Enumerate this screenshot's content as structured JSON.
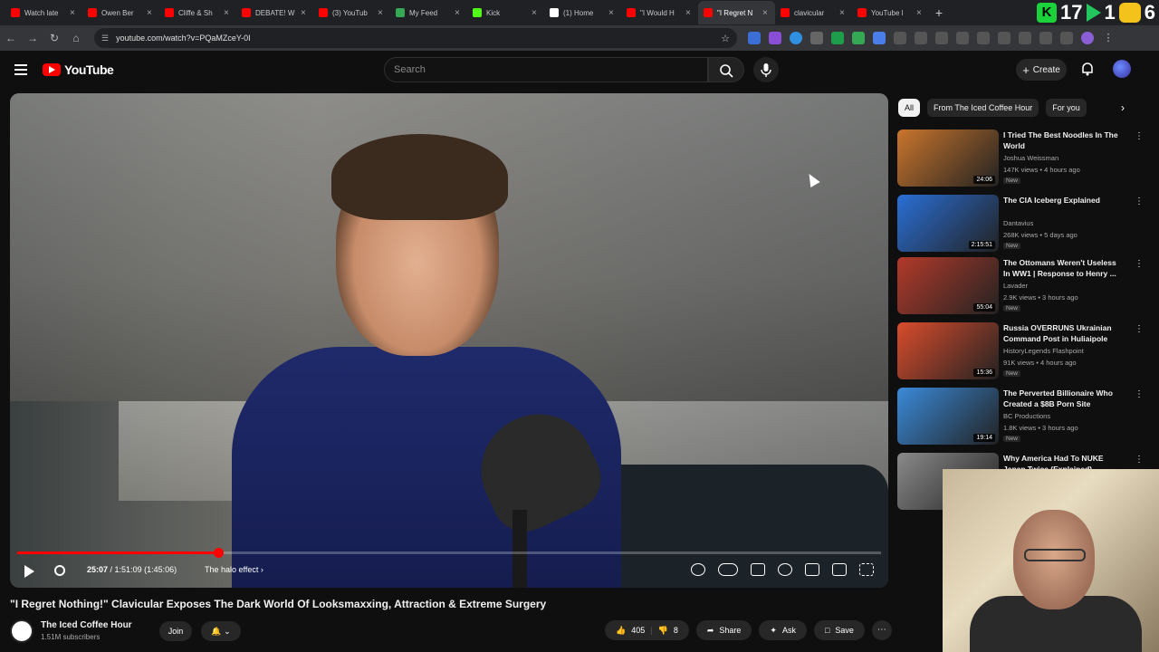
{
  "browser": {
    "tabs": [
      {
        "title": "Watch late",
        "color": "#ff0000"
      },
      {
        "title": "Owen Ber",
        "color": "#ff0000"
      },
      {
        "title": "Cliffe & Sh",
        "color": "#ff0000"
      },
      {
        "title": "DEBATE! W",
        "color": "#ff0000"
      },
      {
        "title": "(3) YouTub",
        "color": "#ff0000"
      },
      {
        "title": "My Feed",
        "color": "#34a853"
      },
      {
        "title": "Kick",
        "color": "#53fc18"
      },
      {
        "title": "(1) Home",
        "color": "#ffffff"
      },
      {
        "title": "\"I Would H",
        "color": "#ff0000"
      },
      {
        "title": "\"I Regret N",
        "color": "#ff0000",
        "active": true
      },
      {
        "title": "clavicular",
        "color": "#ff0000"
      },
      {
        "title": "YouTube l",
        "color": "#ff0000"
      }
    ],
    "new_tab": "+",
    "badge_numbers": [
      "17",
      "1",
      "6"
    ],
    "url": "youtube.com/watch?v=PQaMZceY-0I"
  },
  "youtube": {
    "logo": "YouTube",
    "search_placeholder": "Search",
    "create_label": "Create",
    "player": {
      "progress_fraction": 0.233,
      "time_current": "25:07",
      "time_total": "1:51:09 (1:45:06)",
      "chapter": "The halo effect"
    },
    "video": {
      "title": "\"I Regret Nothing!\" Clavicular Exposes The Dark World Of Looksmaxxing, Attraction & Extreme Surgery",
      "channel": "The Iced Coffee Hour",
      "subscribers": "1.51M subscribers",
      "join": "Join",
      "likes": "405",
      "dislikes": "8",
      "share": "Share",
      "ask": "Ask",
      "save": "Save"
    },
    "chips": [
      {
        "label": "All",
        "active": true
      },
      {
        "label": "From The Iced Coffee Hour",
        "active": false
      },
      {
        "label": "For you",
        "active": false
      }
    ],
    "recommendations": [
      {
        "title": "I Tried The Best Noodles In The World",
        "channel": "Joshua Weissman",
        "meta": "147K views • 4 hours ago",
        "badge": "New",
        "duration": "24:06",
        "thumb": "#c9752c"
      },
      {
        "title": "The CIA Iceberg Explained",
        "channel": "Dantavius",
        "meta": "268K views • 5 days ago",
        "badge": "New",
        "duration": "2:15:51",
        "thumb": "#2a6fd6"
      },
      {
        "title": "The Ottomans Weren't Useless In WW1 | Response to Henry ...",
        "channel": "Lavader",
        "meta": "2.9K views • 3 hours ago",
        "badge": "New",
        "duration": "55:04",
        "thumb": "#b33a2a"
      },
      {
        "title": "Russia OVERRUNS Ukrainian Command Post in Huliaipole",
        "channel": "HistoryLegends Flashpoint",
        "meta": "91K views • 4 hours ago",
        "badge": "New",
        "duration": "15:36",
        "thumb": "#d94c2c"
      },
      {
        "title": "The Perverted Billionaire Who Created a $8B Porn Site",
        "channel": "BC Productions",
        "meta": "1.8K views • 3 hours ago",
        "badge": "New",
        "duration": "19:14",
        "thumb": "#3a8ad9"
      },
      {
        "title": "Why America Had To NUKE Japan Twice (Explained)",
        "channel": "",
        "meta": "",
        "badge": "",
        "duration": "",
        "thumb": "#8a8a8a"
      }
    ]
  }
}
